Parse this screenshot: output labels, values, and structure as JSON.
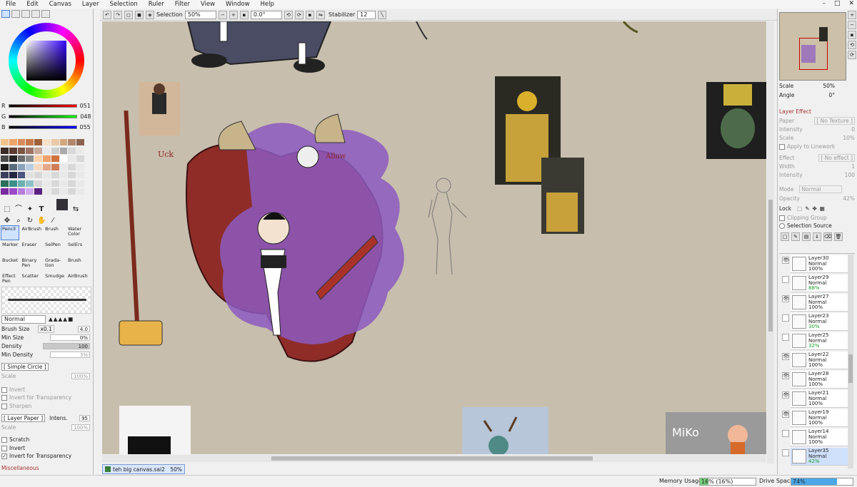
{
  "menu": [
    "File",
    "Edit",
    "Canvas",
    "Layer",
    "Selection",
    "Ruler",
    "Filter",
    "View",
    "Window",
    "Help"
  ],
  "window_buttons": [
    "–",
    "□",
    "✕"
  ],
  "toolbar": {
    "selection_label": "Selection",
    "zoom": "50%",
    "rotation": "0.0°",
    "stabilizer_label": "Stabilizer",
    "stabilizer_value": "12"
  },
  "color": {
    "r": "051",
    "g": "048",
    "b": "055",
    "current": "#333037",
    "r_label": "R",
    "g_label": "G",
    "b_label": "B"
  },
  "swatches": [
    "#f3c28a",
    "#eca46a",
    "#d88c5a",
    "#c67a4a",
    "#a0603a",
    "#f5e2c8",
    "#e8caa8",
    "#d2a880",
    "#b3876b",
    "#8a6451",
    "#3a2b25",
    "#5b3d33",
    "#7a5544",
    "#9b7264",
    "#c8a899",
    "#e9e9e9",
    "#cfcfcf",
    "#aaaaaa",
    "#d8d8d8",
    "#e9e9e9",
    "#4a4a4a",
    "#232323",
    "#6b6b6b",
    "#8d8d8d",
    "#ffd1a6",
    "#f0a06a",
    "#d1733f",
    "#ffffff",
    "#e9e9e9",
    "#d8d8d8",
    "#1b1b1b",
    "#5a6c7a",
    "#8aa2b8",
    "#b9cde0",
    "#f6d9c0",
    "#e4a888",
    "#cf7e57",
    "#e9e9e9",
    "#d8d8d8",
    "#e9e9e9",
    "#3a3f5a",
    "#232842",
    "#4c5580",
    "#e0e0e0",
    "#d8d8d8",
    "#e9e9e9",
    "#d8d8d8",
    "#e9e9e9",
    "#d8d8d8",
    "#e9e9e9",
    "#2a6f5a",
    "#3d8f8a",
    "#6ab0b0",
    "#8fc0c8",
    "#d8d8d8",
    "#e9e9e9",
    "#d8d8d8",
    "#e9e9e9",
    "#d8d8d8",
    "#e9e9e9",
    "#7a2aa0",
    "#9a4ac8",
    "#b77ee0",
    "#d2a8f0",
    "#5a2080",
    "#e9e9e9",
    "#d8d8d8",
    "#e9e9e9",
    "#d8d8d8",
    "#e9e9e9"
  ],
  "brushes": [
    "Pencil",
    "AirBrush",
    "Brush",
    "Water Color",
    "Marker",
    "Eraser",
    "SelPen",
    "SelErs",
    "Bucket",
    "Binary Pen",
    "Grada-tion",
    "Brush",
    "Effect Pen",
    "Scatter",
    "Smudge",
    "AirBrush"
  ],
  "brush": {
    "blend": "Normal",
    "size_label": "Brush Size",
    "size_mult": "x0.1",
    "size": "4.0",
    "min_size_label": "Min Size",
    "min_size": "0%",
    "density_label": "Density",
    "density": "100",
    "min_density_label": "Min Density",
    "min_density": "3%",
    "shape": "[ Simple Circle ]",
    "scale_label": "Scale",
    "scale": "100%",
    "invert": "Invert",
    "invert_transp": "Invert for Transparency",
    "sharpen": "Sharpen",
    "texture": "[ Layer Paper ]",
    "intens_label": "Intens.",
    "intens": "95",
    "tscale_label": "Scale",
    "tscale": "100%",
    "scratch": "Scratch",
    "invert2": "Invert",
    "invert_transp2": "Invert for Transparency",
    "misc": "Miscellaneous"
  },
  "tab": {
    "file": "teh big canvas.sai2",
    "zoom": "50%"
  },
  "status": {
    "memory_label": "Memory Usage",
    "memory": "16% (16%)",
    "memory_pct": 0.16,
    "drive_label": "Drive Space",
    "drive": "74%",
    "drive_pct": 0.74
  },
  "canvas_text": {
    "uck": "Uck",
    "allow": "Allow",
    "miko": "MiKo"
  },
  "nav": {
    "scale_label": "Scale",
    "scale": "50%",
    "angle_label": "Angle",
    "angle": "0°"
  },
  "effect": {
    "title": "Layer Effect",
    "paper": "Paper",
    "paper_val": "[ No Texture ]",
    "intensity": "Intensity",
    "intensity_val": "0",
    "scale": "Scale",
    "scale_val": "10%",
    "apply": "Apply to Linework",
    "effect": "Effect",
    "effect_val": "[ No effect ]",
    "width": "Width",
    "width_val": "1",
    "intensity2": "Intensity",
    "intensity2_val": "100"
  },
  "layer_props": {
    "mode_label": "Mode",
    "mode": "Normal",
    "opacity_label": "Opacity",
    "opacity": "42%",
    "lock": "Lock",
    "clipping": "Clipping Group",
    "source": "Selection Source"
  },
  "layers": [
    {
      "name": "Layer30",
      "mode": "Normal",
      "opacity": "100%",
      "visible": true
    },
    {
      "name": "Layer29",
      "mode": "Normal",
      "opacity": "88%",
      "visible": false
    },
    {
      "name": "Layer27",
      "mode": "Normal",
      "opacity": "100%",
      "visible": true
    },
    {
      "name": "Layer23",
      "mode": "Normal",
      "opacity": "30%",
      "visible": false
    },
    {
      "name": "Layer25",
      "mode": "Normal",
      "opacity": "32%",
      "visible": false
    },
    {
      "name": "Layer22",
      "mode": "Normal",
      "opacity": "100%",
      "visible": true
    },
    {
      "name": "Layer28",
      "mode": "Normal",
      "opacity": "100%",
      "visible": true
    },
    {
      "name": "Layer21",
      "mode": "Normal",
      "opacity": "100%",
      "visible": true
    },
    {
      "name": "Layer19",
      "mode": "Normal",
      "opacity": "100%",
      "visible": true
    },
    {
      "name": "Layer14",
      "mode": "Normal",
      "opacity": "100%",
      "visible": false
    },
    {
      "name": "Layer35",
      "mode": "Normal",
      "opacity": "42%",
      "visible": false,
      "active": true
    }
  ]
}
